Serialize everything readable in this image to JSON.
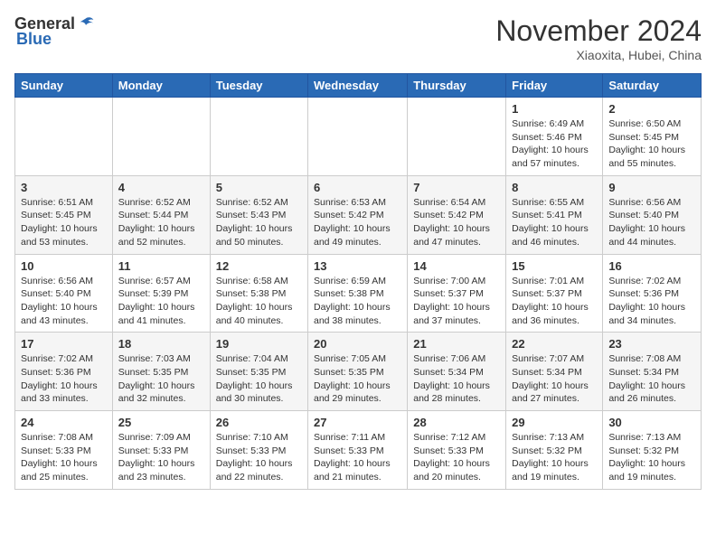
{
  "logo": {
    "general": "General",
    "blue": "Blue"
  },
  "header": {
    "month": "November 2024",
    "location": "Xiaoxita, Hubei, China"
  },
  "weekdays": [
    "Sunday",
    "Monday",
    "Tuesday",
    "Wednesday",
    "Thursday",
    "Friday",
    "Saturday"
  ],
  "weeks": [
    [
      {
        "day": "",
        "info": ""
      },
      {
        "day": "",
        "info": ""
      },
      {
        "day": "",
        "info": ""
      },
      {
        "day": "",
        "info": ""
      },
      {
        "day": "",
        "info": ""
      },
      {
        "day": "1",
        "info": "Sunrise: 6:49 AM\nSunset: 5:46 PM\nDaylight: 10 hours and 57 minutes."
      },
      {
        "day": "2",
        "info": "Sunrise: 6:50 AM\nSunset: 5:45 PM\nDaylight: 10 hours and 55 minutes."
      }
    ],
    [
      {
        "day": "3",
        "info": "Sunrise: 6:51 AM\nSunset: 5:45 PM\nDaylight: 10 hours and 53 minutes."
      },
      {
        "day": "4",
        "info": "Sunrise: 6:52 AM\nSunset: 5:44 PM\nDaylight: 10 hours and 52 minutes."
      },
      {
        "day": "5",
        "info": "Sunrise: 6:52 AM\nSunset: 5:43 PM\nDaylight: 10 hours and 50 minutes."
      },
      {
        "day": "6",
        "info": "Sunrise: 6:53 AM\nSunset: 5:42 PM\nDaylight: 10 hours and 49 minutes."
      },
      {
        "day": "7",
        "info": "Sunrise: 6:54 AM\nSunset: 5:42 PM\nDaylight: 10 hours and 47 minutes."
      },
      {
        "day": "8",
        "info": "Sunrise: 6:55 AM\nSunset: 5:41 PM\nDaylight: 10 hours and 46 minutes."
      },
      {
        "day": "9",
        "info": "Sunrise: 6:56 AM\nSunset: 5:40 PM\nDaylight: 10 hours and 44 minutes."
      }
    ],
    [
      {
        "day": "10",
        "info": "Sunrise: 6:56 AM\nSunset: 5:40 PM\nDaylight: 10 hours and 43 minutes."
      },
      {
        "day": "11",
        "info": "Sunrise: 6:57 AM\nSunset: 5:39 PM\nDaylight: 10 hours and 41 minutes."
      },
      {
        "day": "12",
        "info": "Sunrise: 6:58 AM\nSunset: 5:38 PM\nDaylight: 10 hours and 40 minutes."
      },
      {
        "day": "13",
        "info": "Sunrise: 6:59 AM\nSunset: 5:38 PM\nDaylight: 10 hours and 38 minutes."
      },
      {
        "day": "14",
        "info": "Sunrise: 7:00 AM\nSunset: 5:37 PM\nDaylight: 10 hours and 37 minutes."
      },
      {
        "day": "15",
        "info": "Sunrise: 7:01 AM\nSunset: 5:37 PM\nDaylight: 10 hours and 36 minutes."
      },
      {
        "day": "16",
        "info": "Sunrise: 7:02 AM\nSunset: 5:36 PM\nDaylight: 10 hours and 34 minutes."
      }
    ],
    [
      {
        "day": "17",
        "info": "Sunrise: 7:02 AM\nSunset: 5:36 PM\nDaylight: 10 hours and 33 minutes."
      },
      {
        "day": "18",
        "info": "Sunrise: 7:03 AM\nSunset: 5:35 PM\nDaylight: 10 hours and 32 minutes."
      },
      {
        "day": "19",
        "info": "Sunrise: 7:04 AM\nSunset: 5:35 PM\nDaylight: 10 hours and 30 minutes."
      },
      {
        "day": "20",
        "info": "Sunrise: 7:05 AM\nSunset: 5:35 PM\nDaylight: 10 hours and 29 minutes."
      },
      {
        "day": "21",
        "info": "Sunrise: 7:06 AM\nSunset: 5:34 PM\nDaylight: 10 hours and 28 minutes."
      },
      {
        "day": "22",
        "info": "Sunrise: 7:07 AM\nSunset: 5:34 PM\nDaylight: 10 hours and 27 minutes."
      },
      {
        "day": "23",
        "info": "Sunrise: 7:08 AM\nSunset: 5:34 PM\nDaylight: 10 hours and 26 minutes."
      }
    ],
    [
      {
        "day": "24",
        "info": "Sunrise: 7:08 AM\nSunset: 5:33 PM\nDaylight: 10 hours and 25 minutes."
      },
      {
        "day": "25",
        "info": "Sunrise: 7:09 AM\nSunset: 5:33 PM\nDaylight: 10 hours and 23 minutes."
      },
      {
        "day": "26",
        "info": "Sunrise: 7:10 AM\nSunset: 5:33 PM\nDaylight: 10 hours and 22 minutes."
      },
      {
        "day": "27",
        "info": "Sunrise: 7:11 AM\nSunset: 5:33 PM\nDaylight: 10 hours and 21 minutes."
      },
      {
        "day": "28",
        "info": "Sunrise: 7:12 AM\nSunset: 5:33 PM\nDaylight: 10 hours and 20 minutes."
      },
      {
        "day": "29",
        "info": "Sunrise: 7:13 AM\nSunset: 5:32 PM\nDaylight: 10 hours and 19 minutes."
      },
      {
        "day": "30",
        "info": "Sunrise: 7:13 AM\nSunset: 5:32 PM\nDaylight: 10 hours and 19 minutes."
      }
    ]
  ]
}
